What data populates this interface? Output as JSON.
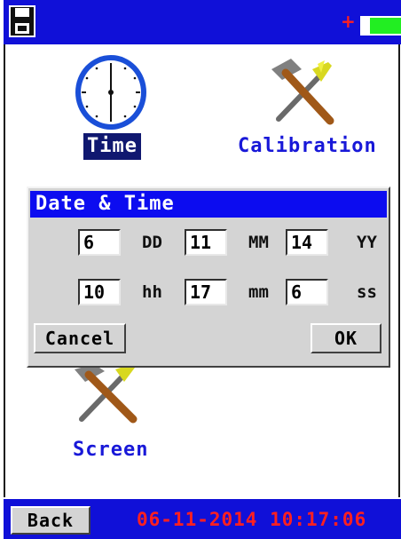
{
  "topbar": {
    "disk_icon": "floppy-disk-icon",
    "battery_icon": "battery-icon",
    "battery_plus": "+",
    "battery_level": 0.8
  },
  "tiles": {
    "time": {
      "label": "Time",
      "icon": "clock-icon"
    },
    "calibration": {
      "label": "Calibration",
      "icon": "hammer-screwdriver-icon"
    },
    "screen": {
      "label": "Screen",
      "icon": "hammer-screwdriver-icon"
    }
  },
  "dialog": {
    "title": "Date & Time",
    "row1": {
      "day": "6",
      "day_unit": "DD",
      "month": "11",
      "month_unit": "MM",
      "year": "14",
      "year_unit": "YY"
    },
    "row2": {
      "hour": "10",
      "hour_unit": "hh",
      "minute": "17",
      "minute_unit": "mm",
      "second": "6",
      "second_unit": "ss"
    },
    "cancel_label": "Cancel",
    "ok_label": "OK"
  },
  "bottombar": {
    "back_label": "Back",
    "datetime": "06-11-2014 10:17:06"
  },
  "colors": {
    "bar": "#1010d8",
    "dialog_title": "#0c0cf0",
    "datetime": "#ff2020",
    "battery": "#22ee22"
  }
}
